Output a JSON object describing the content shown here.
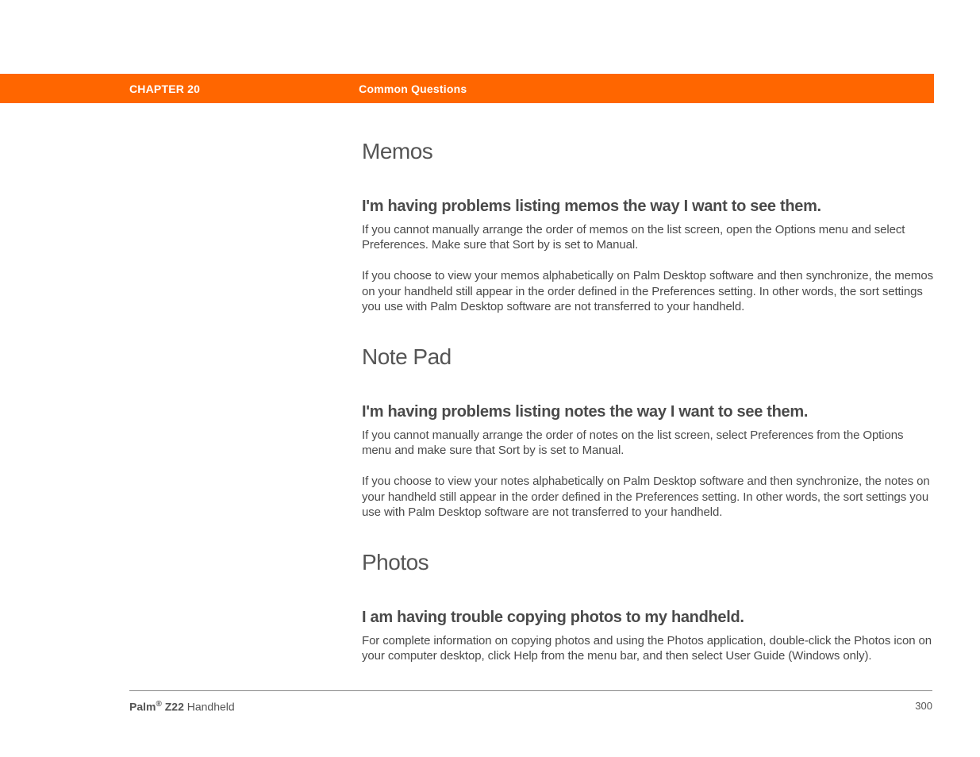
{
  "header": {
    "chapter": "CHAPTER 20",
    "section": "Common Questions"
  },
  "content": {
    "sections": [
      {
        "heading": "Memos",
        "questions": [
          {
            "title": "I'm having problems listing memos the way I want to see them.",
            "paragraphs": [
              "If you cannot manually arrange the order of memos on the list screen, open the Options menu and select Preferences. Make sure that Sort by is set to Manual.",
              "If you choose to view your memos alphabetically on Palm Desktop software and then synchronize, the memos on your handheld still appear in the order defined in the Preferences setting. In other words, the sort settings you use with Palm Desktop software are not transferred to your handheld."
            ]
          }
        ]
      },
      {
        "heading": "Note Pad",
        "questions": [
          {
            "title": "I'm having problems listing notes the way I want to see them.",
            "paragraphs": [
              "If you cannot manually arrange the order of notes on the list screen, select Preferences from the Options menu and make sure that Sort by is set to Manual.",
              "If you choose to view your notes alphabetically on Palm Desktop software and then synchronize, the notes on your handheld still appear in the order defined in the Preferences setting. In other words, the sort settings you use with Palm Desktop software are not transferred to your handheld."
            ]
          }
        ]
      },
      {
        "heading": "Photos",
        "questions": [
          {
            "title": "I am having trouble copying photos to my handheld.",
            "paragraphs": [
              "For complete information on copying photos and using the Photos application, double-click the Photos icon on your computer desktop, click Help from the menu bar, and then select User Guide (Windows only)."
            ]
          }
        ]
      }
    ]
  },
  "footer": {
    "product_brand": "Palm",
    "registered": "®",
    "product_model": " Z22",
    "product_suffix": " Handheld",
    "page_number": "300"
  }
}
